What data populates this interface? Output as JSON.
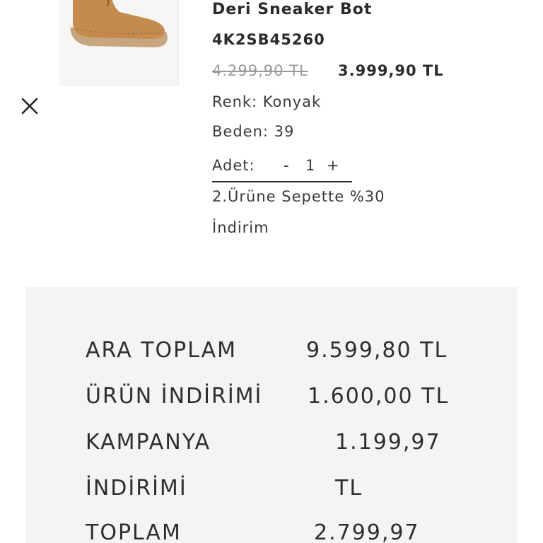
{
  "product": {
    "name": "Deri Sneaker Bot",
    "sku": "4K2SB45260",
    "old_price": "4.299,90 TL",
    "new_price": "3.999,90 TL",
    "color_line": "Renk: Konyak",
    "size_line": "Beden: 39",
    "quantity_label": "Adet:",
    "quantity_minus": "-",
    "quantity_value": "1",
    "quantity_plus": "+",
    "promo_line1": "2.Ürüne Sepette %30",
    "promo_line2": "İndirim",
    "image_icon": "shoe-image",
    "remove_icon": "close-icon"
  },
  "summary": {
    "subtotal_label": "ARA TOPLAM",
    "subtotal_value": "9.599,80 TL",
    "product_discount_label": "ÜRÜN İNDİRİMİ",
    "product_discount_value": "1.600,00 TL",
    "campaign_label_line1": "KAMPANYA",
    "campaign_label_line2": "İNDİRİMİ",
    "campaign_value_line1": "1.199,97",
    "campaign_value_line2": "TL",
    "total_label": "TOPLAM",
    "total_value": "2.799,97"
  },
  "colors": {
    "shoe": "#c48a4e",
    "sole": "#c7a57e",
    "summary_bg": "#f4f4f4",
    "text": "#2b2b2b",
    "muted": "#9a9a9a"
  }
}
